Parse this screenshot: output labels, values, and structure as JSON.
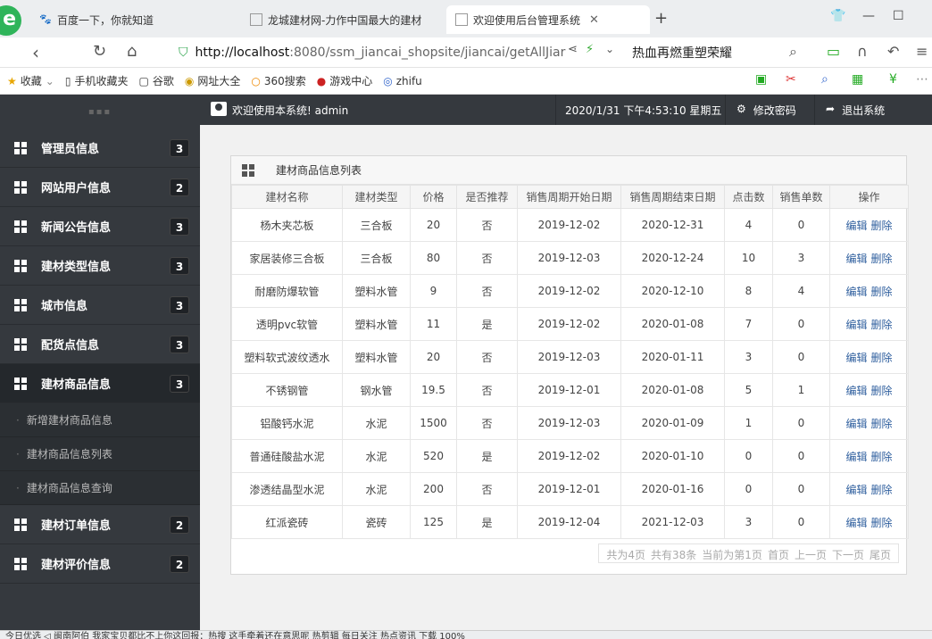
{
  "browser": {
    "tabs": [
      {
        "title": "百度一下，你就知道",
        "favicon": "paw-icon"
      },
      {
        "title": "龙城建材网-力作中国最大的建材",
        "favicon": "page-icon"
      },
      {
        "title": "欢迎使用后台管理系统",
        "favicon": "page-icon"
      }
    ],
    "new_tab": "+",
    "url_host": "http://localhost",
    "url_rest": ":8080/ssm_jiancai_shopsite/jiancai/getAllJiar",
    "search_text": "热血再燃重塑荣耀",
    "bookmarks": [
      {
        "label": "收藏",
        "icon": "star-icon"
      },
      {
        "label": "手机收藏夹",
        "icon": "phone-icon"
      },
      {
        "label": "谷歌",
        "icon": "page-icon"
      },
      {
        "label": "网址大全",
        "icon": "globe-icon"
      },
      {
        "label": "360搜索",
        "icon": "search-icon"
      },
      {
        "label": "游戏中心",
        "icon": "game-icon"
      },
      {
        "label": "zhifu",
        "icon": "page-icon"
      }
    ],
    "status_text": "今日优选  ◁ 闽南阿伯 我家宝贝都比不上你这回报：热搜 这手牵着还在意思呢        热剪辑    每日关注    热点资讯               下载          100%"
  },
  "topbar": {
    "welcome": "欢迎使用本系统! admin",
    "datetime": "2020/1/31 下午4:53:10 星期五",
    "change_password": "修改密码",
    "logout": "退出系统"
  },
  "sidebar": {
    "items": [
      {
        "label": "管理员信息",
        "count": "3"
      },
      {
        "label": "网站用户信息",
        "count": "2"
      },
      {
        "label": "新闻公告信息",
        "count": "3"
      },
      {
        "label": "建材类型信息",
        "count": "3"
      },
      {
        "label": "城市信息",
        "count": "3"
      },
      {
        "label": "配货点信息",
        "count": "3"
      },
      {
        "label": "建材商品信息",
        "count": "3"
      },
      {
        "label": "建材订单信息",
        "count": "2"
      },
      {
        "label": "建材评价信息",
        "count": "2"
      }
    ],
    "subitems": [
      "新增建材商品信息",
      "建材商品信息列表",
      "建材商品信息查询"
    ]
  },
  "panel": {
    "title": "建材商品信息列表",
    "columns": [
      "建材名称",
      "建材类型",
      "价格",
      "是否推荐",
      "销售周期开始日期",
      "销售周期结束日期",
      "点击数",
      "销售单数",
      "操作"
    ],
    "edit_label": "编辑",
    "delete_label": "删除",
    "rows": [
      [
        "杨木夹芯板",
        "三合板",
        "20",
        "否",
        "2019-12-02",
        "2020-12-31",
        "4",
        "0"
      ],
      [
        "家居装修三合板",
        "三合板",
        "80",
        "否",
        "2019-12-03",
        "2020-12-24",
        "10",
        "3"
      ],
      [
        "耐磨防爆软管",
        "塑料水管",
        "9",
        "否",
        "2019-12-02",
        "2020-12-10",
        "8",
        "4"
      ],
      [
        "透明pvc软管",
        "塑料水管",
        "11",
        "是",
        "2019-12-02",
        "2020-01-08",
        "7",
        "0"
      ],
      [
        "塑料软式波纹透水",
        "塑料水管",
        "20",
        "否",
        "2019-12-03",
        "2020-01-11",
        "3",
        "0"
      ],
      [
        "不锈钢管",
        "钢水管",
        "19.5",
        "否",
        "2019-12-01",
        "2020-01-08",
        "5",
        "1"
      ],
      [
        "铝酸钙水泥",
        "水泥",
        "1500",
        "否",
        "2019-12-03",
        "2020-01-09",
        "1",
        "0"
      ],
      [
        "普通硅酸盐水泥",
        "水泥",
        "520",
        "是",
        "2019-12-02",
        "2020-01-10",
        "0",
        "0"
      ],
      [
        "渗透结晶型水泥",
        "水泥",
        "200",
        "否",
        "2019-12-01",
        "2020-01-16",
        "0",
        "0"
      ],
      [
        "红派瓷砖",
        "瓷砖",
        "125",
        "是",
        "2019-12-04",
        "2021-12-03",
        "3",
        "0"
      ]
    ],
    "pager": [
      "共为4页",
      "共有38条",
      "当前为第1页",
      "首页",
      "上一页",
      "下一页",
      "尾页"
    ]
  }
}
